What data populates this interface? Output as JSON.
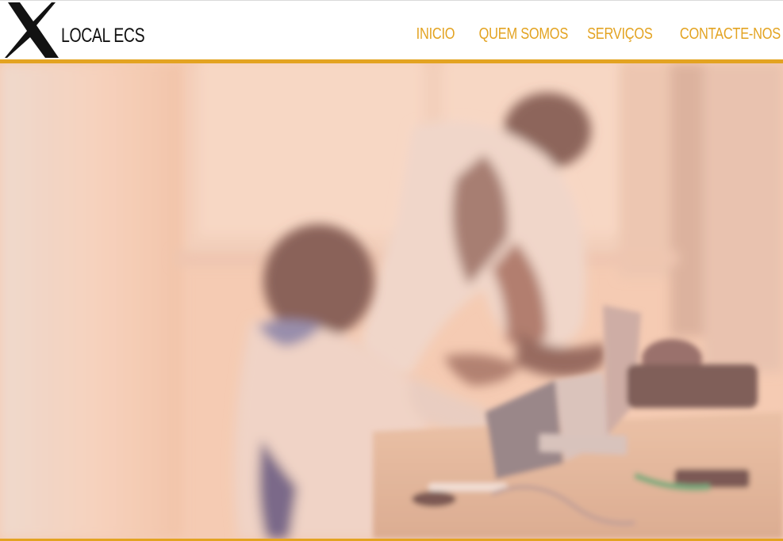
{
  "header": {
    "logo_icon": "x-logo-icon",
    "brand_name": "LOCAL ECS"
  },
  "nav": {
    "items": [
      {
        "label": "INICIO"
      },
      {
        "label": "QUEM SOMOS"
      },
      {
        "label": "SERVIÇOS"
      },
      {
        "label": "CONTACTE-NOS"
      }
    ]
  },
  "hero": {
    "image_subject": "hero-photo"
  },
  "colors": {
    "accent": "#e3a321",
    "brand_text": "#111111",
    "hero_tint": "#f4cdb6"
  }
}
